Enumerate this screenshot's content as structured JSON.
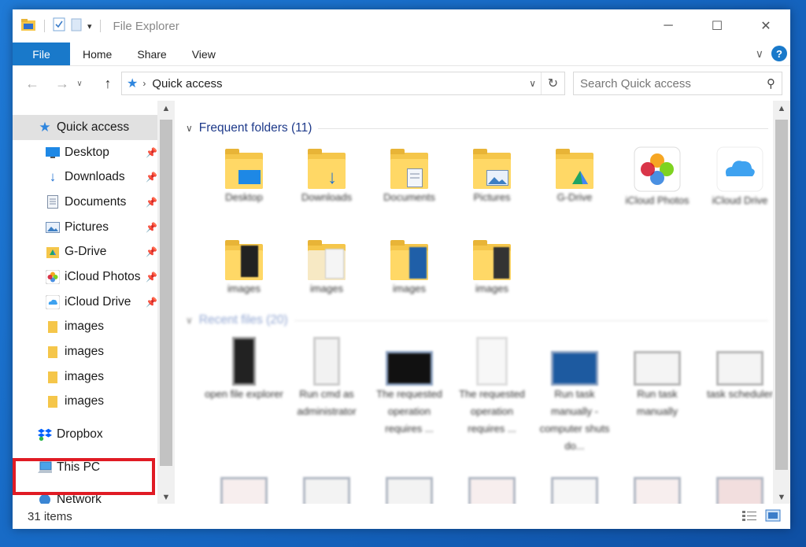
{
  "window": {
    "title": "File Explorer"
  },
  "ribbon": {
    "tabs": [
      "File",
      "Home",
      "Share",
      "View"
    ]
  },
  "address": {
    "location": "Quick access",
    "search_placeholder": "Search Quick access"
  },
  "nav": {
    "quick_access": "Quick access",
    "pinned": [
      {
        "label": "Desktop",
        "icon": "desktop-icon"
      },
      {
        "label": "Downloads",
        "icon": "downloads-icon"
      },
      {
        "label": "Documents",
        "icon": "documents-icon"
      },
      {
        "label": "Pictures",
        "icon": "pictures-icon"
      },
      {
        "label": "G-Drive",
        "icon": "g-drive-icon"
      },
      {
        "label": "iCloud Photos",
        "icon": "icloud-photos-icon"
      },
      {
        "label": "iCloud Drive",
        "icon": "icloud-drive-icon"
      }
    ],
    "folders": [
      "images",
      "images",
      "images",
      "images"
    ],
    "dropbox": "Dropbox",
    "this_pc": "This PC",
    "network": "Network"
  },
  "frequent": {
    "header": "Frequent folders (11)",
    "items": [
      "Desktop",
      "Downloads",
      "Documents",
      "Pictures",
      "G-Drive",
      "iCloud Photos",
      "iCloud Drive",
      "images",
      "images",
      "images",
      "images"
    ]
  },
  "recent": {
    "header": "Recent files (20)",
    "items": [
      "open file explorer",
      "Run cmd as administrator",
      "The requested operation requires ...",
      "The requested operation requires ...",
      "Run task manually - computer shuts do...",
      "Run task manually",
      "task scheduler"
    ]
  },
  "status": {
    "count": "31 items"
  },
  "colors": {
    "accent": "#1979ca",
    "highlight": "#e01b24",
    "folder": "#ffd866"
  }
}
